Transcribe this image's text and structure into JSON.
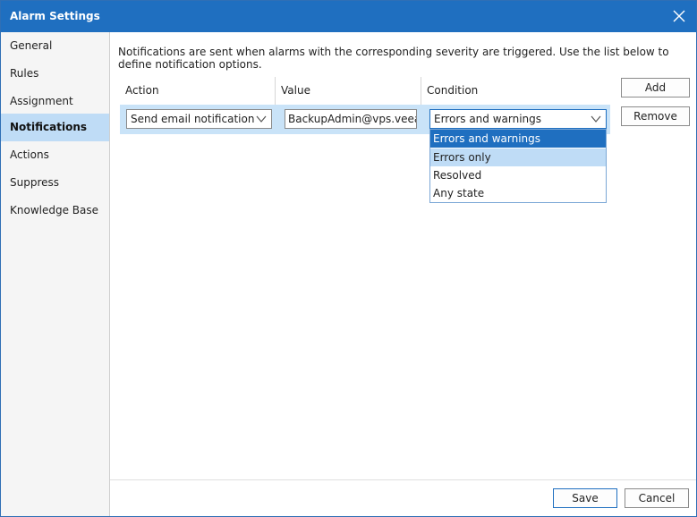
{
  "window": {
    "title": "Alarm Settings"
  },
  "sidebar": {
    "items": [
      {
        "label": "General",
        "selected": false
      },
      {
        "label": "Rules",
        "selected": false
      },
      {
        "label": "Assignment",
        "selected": false
      },
      {
        "label": "Notifications",
        "selected": true
      },
      {
        "label": "Actions",
        "selected": false
      },
      {
        "label": "Suppress",
        "selected": false
      },
      {
        "label": "Knowledge Base",
        "selected": false
      }
    ]
  },
  "main": {
    "description": "Notifications are sent when alarms with the corresponding severity are triggered. Use the list below to define notification options.",
    "table": {
      "columns": [
        "Action",
        "Value",
        "Condition"
      ],
      "rows": [
        {
          "action": "Send email notification",
          "value": "BackupAdmin@vps.veeam.",
          "condition": "Errors and warnings"
        }
      ]
    },
    "condition_dropdown": {
      "options": [
        "Errors and warnings",
        "Errors only",
        "Resolved",
        "Any state"
      ],
      "selected": "Errors and warnings",
      "hovered": "Errors only"
    },
    "buttons": {
      "add": "Add",
      "remove": "Remove"
    }
  },
  "footer": {
    "save": "Save",
    "cancel": "Cancel"
  },
  "colors": {
    "titlebar": "#1f6fc0",
    "selection": "#bfdcf6",
    "row_highlight": "#c9e3f8"
  }
}
